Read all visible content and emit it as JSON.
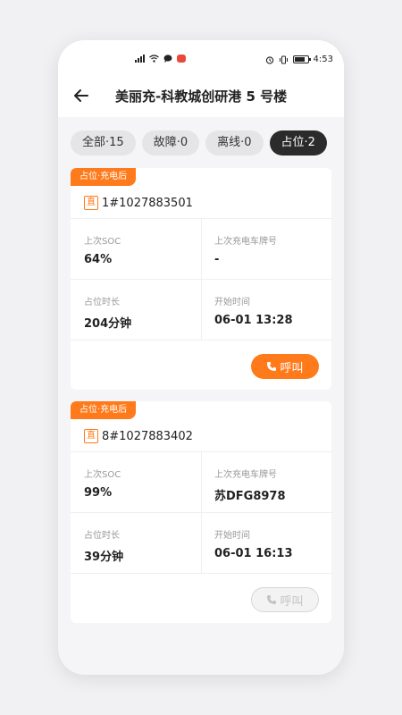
{
  "status_bar": {
    "time": "4:53"
  },
  "nav": {
    "title": "美丽充-科教城创研港 5 号楼"
  },
  "tabs": [
    {
      "label": "全部·15"
    },
    {
      "label": "故障·0"
    },
    {
      "label": "离线·0"
    },
    {
      "label": "占位·2"
    }
  ],
  "cards": [
    {
      "badge": "占位·充电后",
      "type_tag": "直",
      "charger_id": "1#1027883501",
      "soc_label": "上次SOC",
      "soc_value": "64%",
      "plate_label": "上次充电车牌号",
      "plate_value": "-",
      "duration_label": "占位时长",
      "duration_value": "204分钟",
      "start_label": "开始时间",
      "start_value": "06-01 13:28",
      "call_label": "呼叫"
    },
    {
      "badge": "占位·充电后",
      "type_tag": "直",
      "charger_id": "8#1027883402",
      "soc_label": "上次SOC",
      "soc_value": "99%",
      "plate_label": "上次充电车牌号",
      "plate_value": "苏DFG8978",
      "duration_label": "占位时长",
      "duration_value": "39分钟",
      "start_label": "开始时间",
      "start_value": "06-01 16:13",
      "call_label": "呼叫"
    }
  ],
  "colors": {
    "accent": "#ff7a1a",
    "active_tab": "#2b2b2b"
  }
}
